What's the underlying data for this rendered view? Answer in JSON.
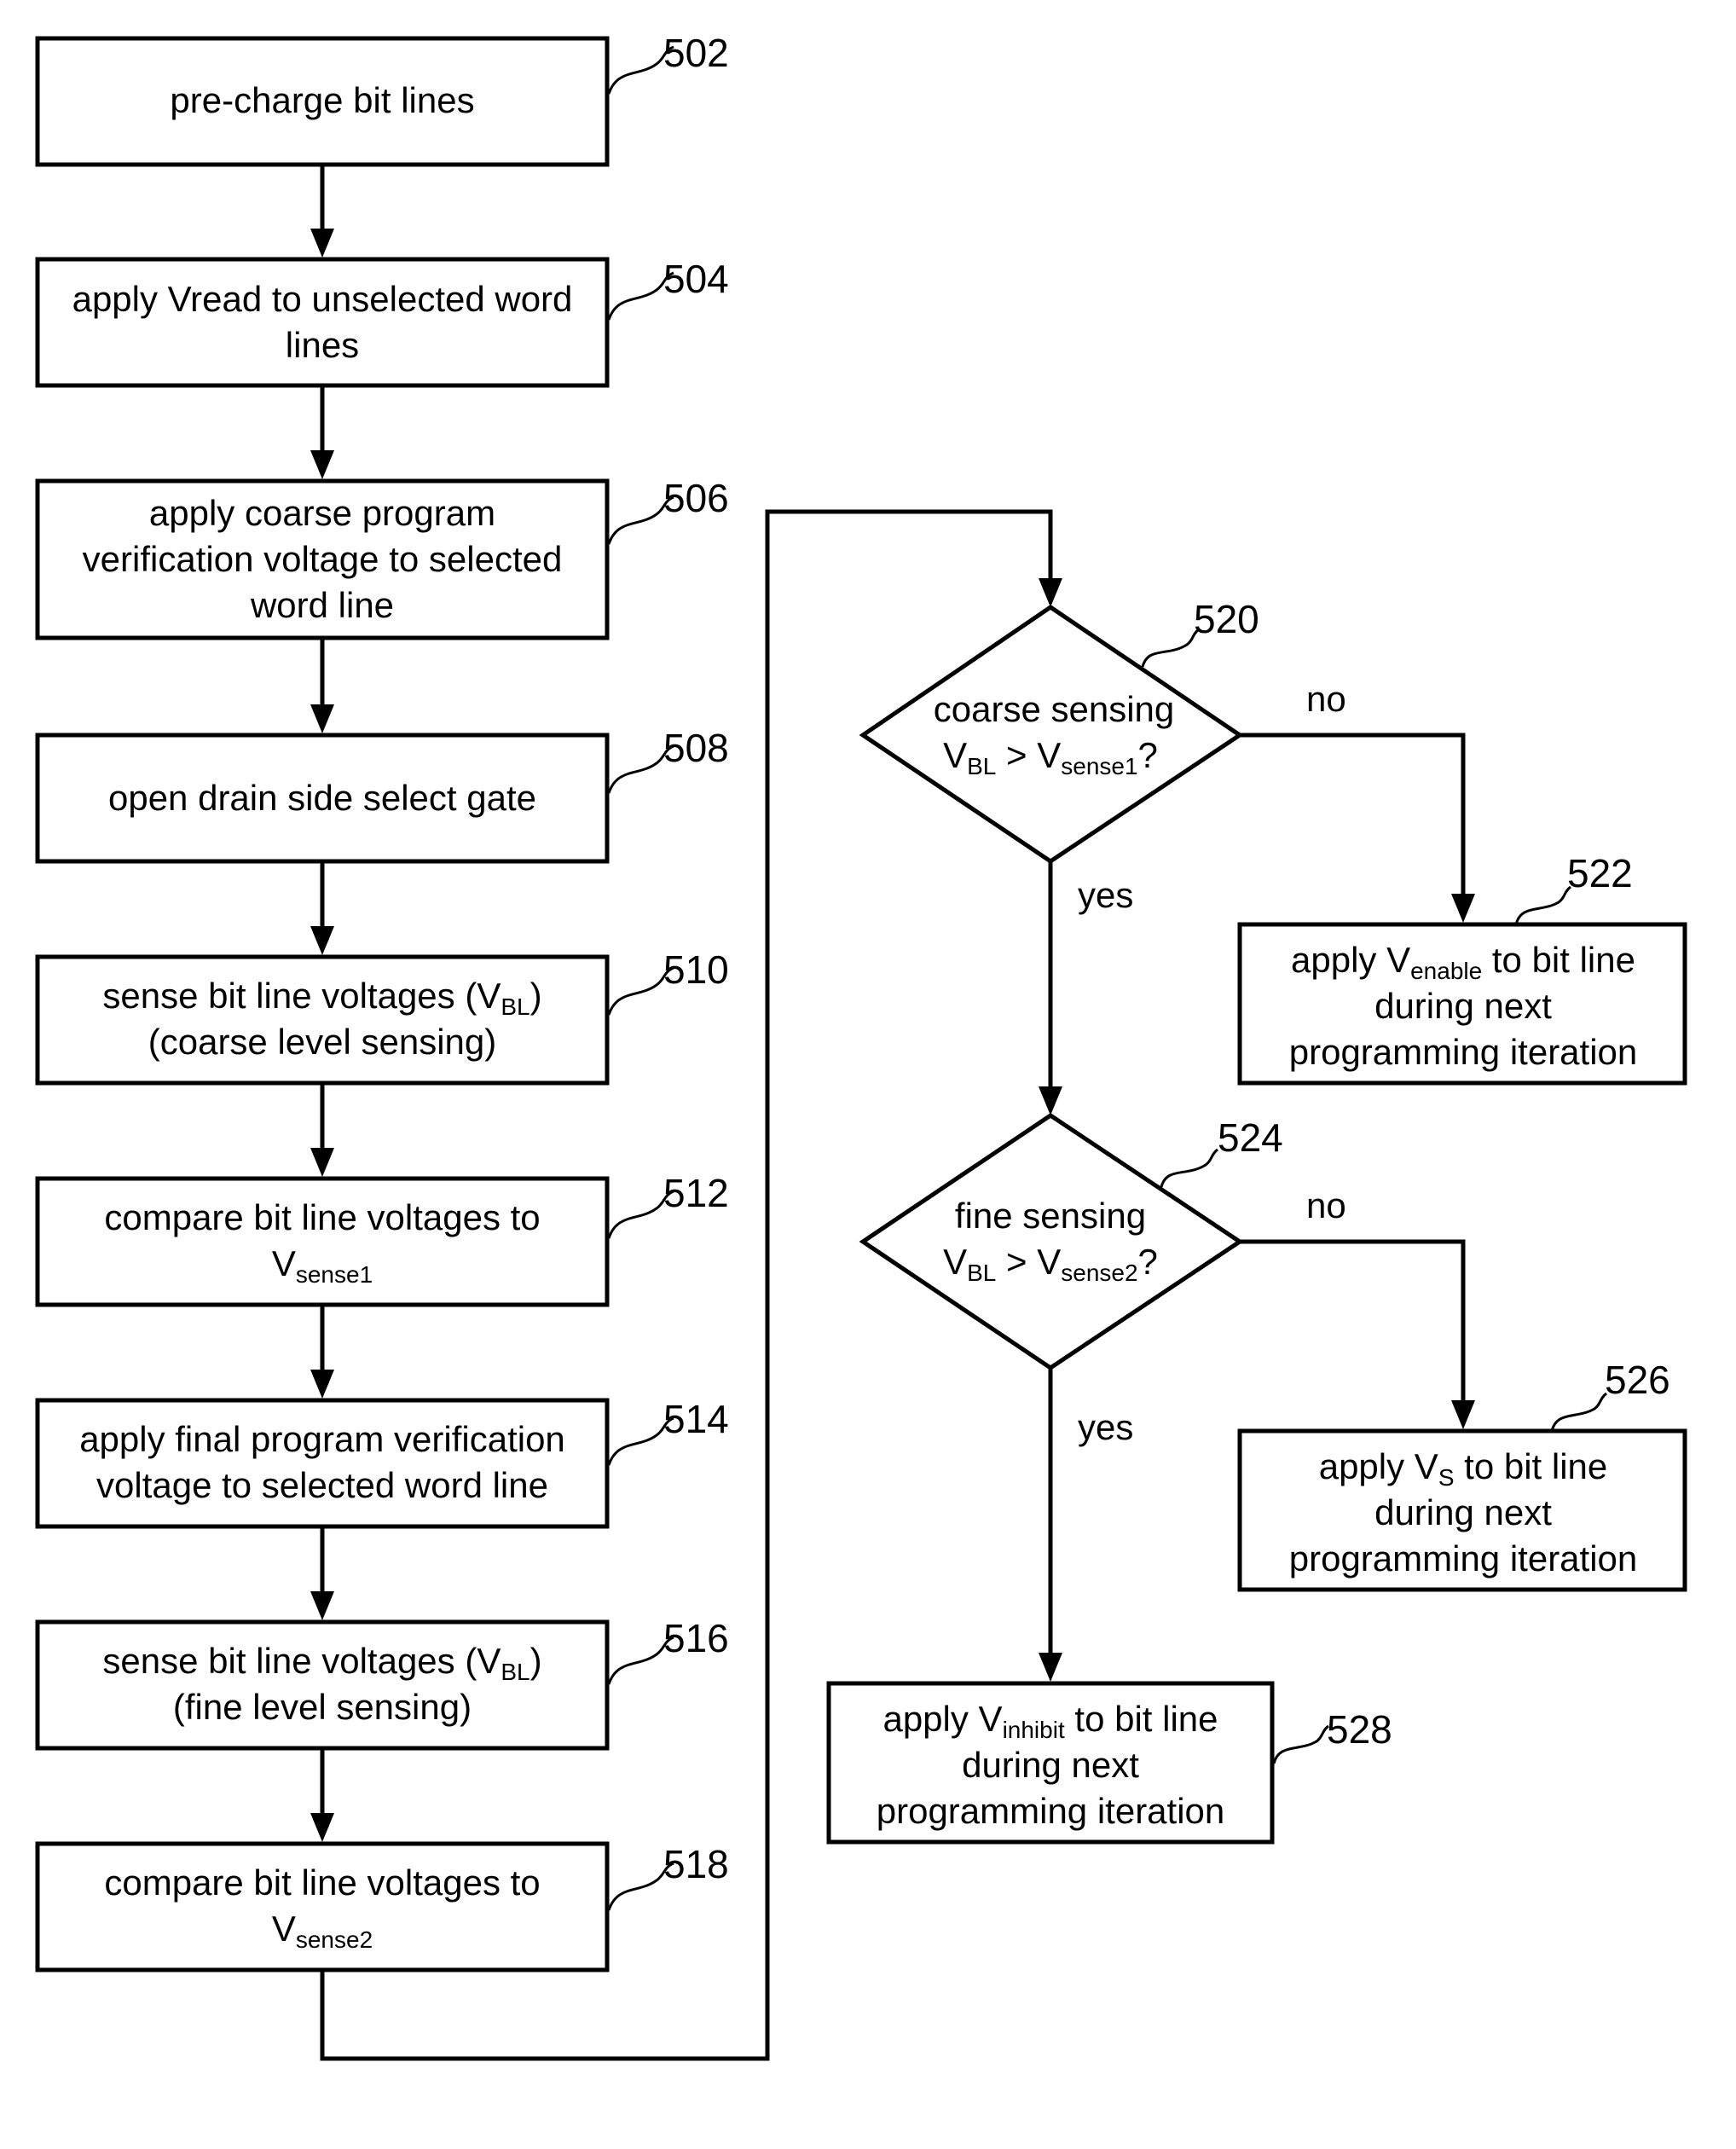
{
  "steps": {
    "s502": {
      "ref": "502",
      "lines": [
        "pre-charge bit lines"
      ]
    },
    "s504": {
      "ref": "504",
      "lines": [
        "apply Vread to unselected word",
        "lines"
      ]
    },
    "s506": {
      "ref": "506",
      "lines": [
        "apply coarse program",
        "verification voltage to selected",
        "word line"
      ]
    },
    "s508": {
      "ref": "508",
      "lines": [
        "open drain side select gate"
      ]
    },
    "s510": {
      "ref": "510",
      "line1_pre": "sense bit line voltages (V",
      "line1_sub": "BL",
      "line1_post": ")",
      "line2": "(coarse level sensing)"
    },
    "s512": {
      "ref": "512",
      "line1": "compare bit line voltages to",
      "line2_main": "V",
      "line2_sub": "sense1"
    },
    "s514": {
      "ref": "514",
      "lines": [
        "apply final program verification",
        "voltage to selected word line"
      ]
    },
    "s516": {
      "ref": "516",
      "line1_pre": "sense bit line voltages (V",
      "line1_sub": "BL",
      "line1_post": ")",
      "line2": "(fine level sensing)"
    },
    "s518": {
      "ref": "518",
      "line1": "compare bit line voltages to",
      "line2_main": "V",
      "line2_sub": "sense2"
    },
    "d520": {
      "ref": "520",
      "line1": "coarse sensing",
      "v1": "V",
      "s1": "BL",
      "op": " > V",
      "s2": "sense1",
      "q": "?"
    },
    "s522": {
      "ref": "522",
      "pre": "apply V",
      "sub": "enable",
      "post": " to bit line",
      "line2": "during next",
      "line3": "programming iteration"
    },
    "d524": {
      "ref": "524",
      "line1": "fine sensing",
      "v1": "V",
      "s1": "BL",
      "op": " > V",
      "s2": "sense2",
      "q": "?"
    },
    "s526": {
      "ref": "526",
      "pre": "apply V",
      "sub": "S",
      "post": " to bit line",
      "line2": "during next",
      "line3": "programming iteration"
    },
    "s528": {
      "ref": "528",
      "pre": "apply V",
      "sub": "inhibit",
      "post": " to bit line",
      "line2": "during next",
      "line3": "programming iteration"
    }
  },
  "labels": {
    "no": "no",
    "yes": "yes"
  }
}
